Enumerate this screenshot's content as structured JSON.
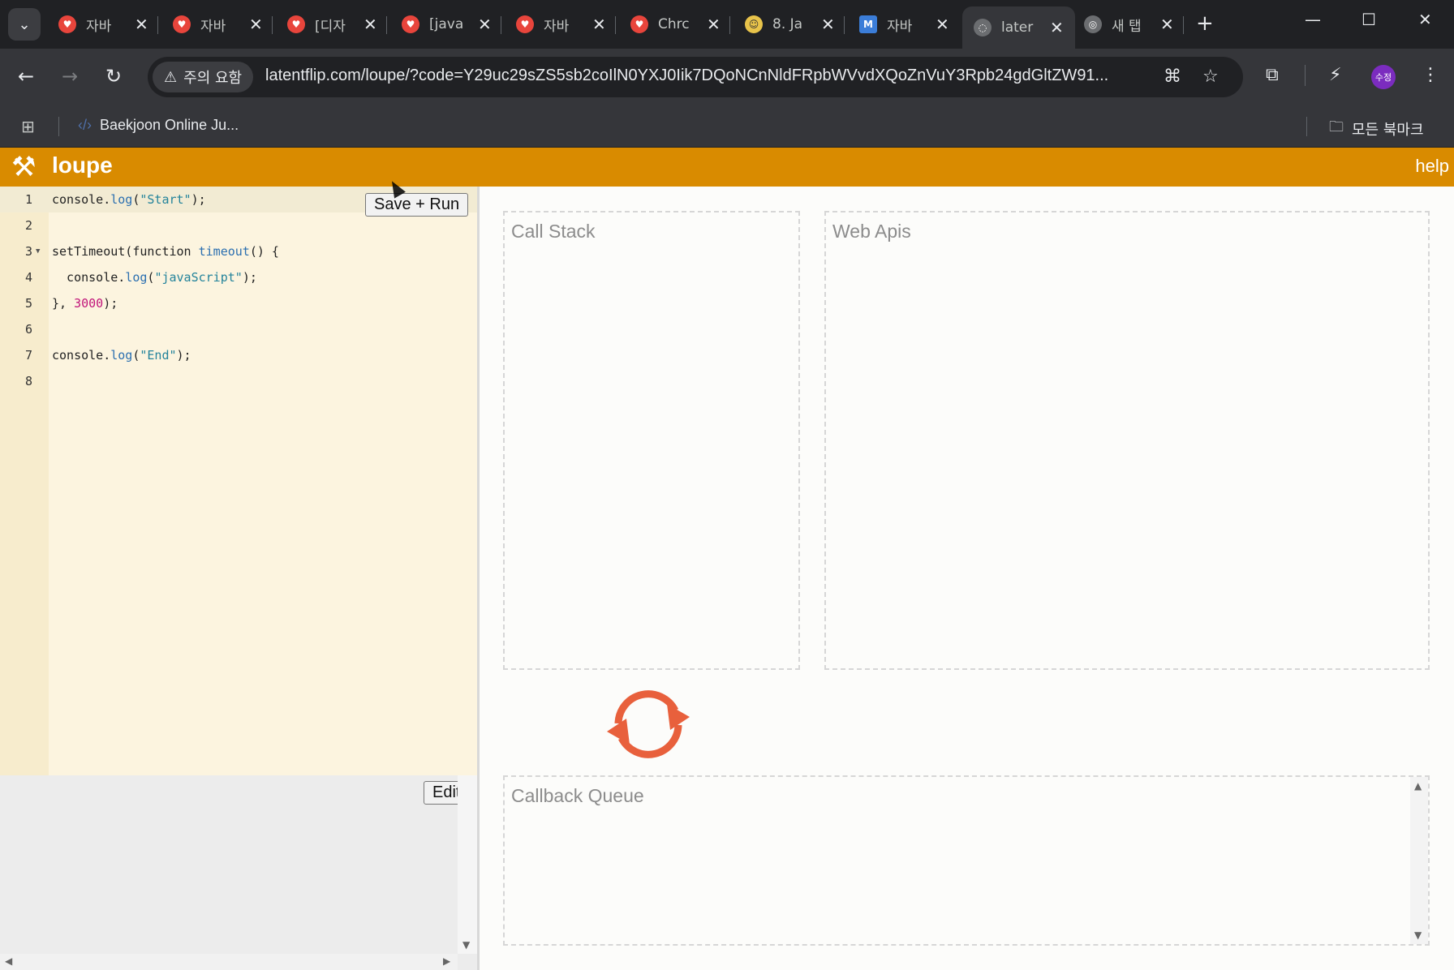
{
  "browser": {
    "tabs": [
      {
        "title": "자바",
        "favicon_color": "#e8453c",
        "favicon_glyph": "♥"
      },
      {
        "title": "자바",
        "favicon_color": "#e8453c",
        "favicon_glyph": "♥"
      },
      {
        "title": "[디자",
        "favicon_color": "#e8453c",
        "favicon_glyph": "♥"
      },
      {
        "title": "[java",
        "favicon_color": "#e8453c",
        "favicon_glyph": "♥"
      },
      {
        "title": "자바",
        "favicon_color": "#e8453c",
        "favicon_glyph": "♥"
      },
      {
        "title": "Chrc",
        "favicon_color": "#e8453c",
        "favicon_glyph": "♥"
      },
      {
        "title": "8. Ja",
        "favicon_color": "#e8c34a",
        "favicon_glyph": "☺"
      },
      {
        "title": "자바",
        "favicon_color": "#3b7dd8",
        "favicon_glyph": "M"
      },
      {
        "title": "later",
        "favicon_color": "#6b6d70",
        "favicon_glyph": "◌"
      },
      {
        "title": "새 탭",
        "favicon_color": "#6b6d70",
        "favicon_glyph": "◎"
      }
    ],
    "active_tab": 8,
    "security_chip": "주의 요함",
    "url": "latentflip.com/loupe/?code=Y29uc29sZS5sb2coIlN0YXJ0Iik7DQoNCnNldFRpbWVvdXQoZnVuY3Rpb24gdGltZW91...",
    "profile_label": "수정",
    "bookmarks": [
      {
        "label": "Baekjoon Online Ju..."
      }
    ],
    "all_bookmarks_label": "모든 북마크"
  },
  "app": {
    "title": "loupe",
    "help_label": "help",
    "save_run_label": "Save + Run",
    "edit_label": "Edit",
    "code_lines": [
      {
        "n": "1"
      },
      {
        "n": "2"
      },
      {
        "n": "3"
      },
      {
        "n": "4"
      },
      {
        "n": "5"
      },
      {
        "n": "6"
      },
      {
        "n": "7"
      },
      {
        "n": "8"
      }
    ],
    "code": {
      "l1_obj": "console",
      "l1_dot": ".",
      "l1_fn": "log",
      "l1_open": "(",
      "l1_str": "\"Start\"",
      "l1_close": ");",
      "l3_a": "setTimeout(function ",
      "l3_fn": "timeout",
      "l3_b": "() {",
      "l4_obj": "  console",
      "l4_dot": ".",
      "l4_fn": "log",
      "l4_open": "(",
      "l4_str": "\"javaScript\"",
      "l4_close": ");",
      "l5_a": "}, ",
      "l5_num": "3000",
      "l5_b": ");",
      "l7_obj": "console",
      "l7_dot": ".",
      "l7_fn": "log",
      "l7_open": "(",
      "l7_str": "\"End\"",
      "l7_close": ");"
    },
    "panels": {
      "call_stack": "Call Stack",
      "web_apis": "Web Apis",
      "callback_queue": "Callback Queue"
    },
    "colors": {
      "header": "#d98b00",
      "loop_icon": "#e8603c"
    }
  }
}
